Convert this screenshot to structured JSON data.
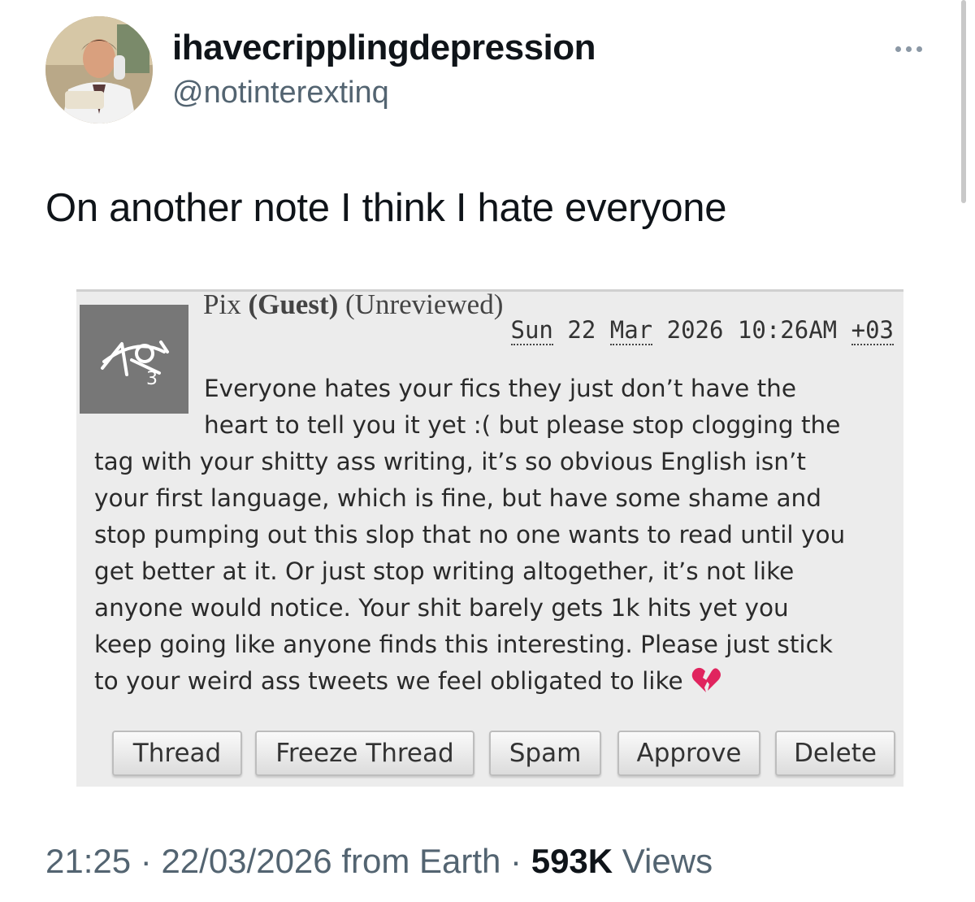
{
  "tweet": {
    "display_name": "ihavecripplingdepression",
    "handle": "@notinterextinq",
    "text": "On another note I think I hate everyone",
    "meta": {
      "time": "21:25",
      "sep1": " · ",
      "date": "22/03/2026",
      "source": " from Earth",
      "sep2": " · ",
      "views_count": "593K",
      "views_label": " Views"
    }
  },
  "comment": {
    "author": "Pix",
    "guest_label": "(Guest)",
    "status_label": "(Unreviewed)",
    "timestamp": {
      "day": "Sun",
      "date": "22",
      "month": "Mar",
      "year": "2026",
      "time": "10:26AM",
      "tz": "+03"
    },
    "body_lines": [
      "Everyone hates your fics they just don’t have the",
      "heart to tell you it yet :( but please stop clogging the",
      "tag with your shitty ass writing, it’s so obvious English isn’t",
      "your first language, which is fine, but have some shame and",
      "stop pumping out this slop that no one wants to read until you",
      "get better at it. Or just stop writing altogether, it’s not like",
      "anyone would notice. Your shit barely gets 1k hits yet you",
      "keep going like anyone finds this interesting. Please just stick",
      "to your weird ass tweets we feel obligated to like"
    ],
    "buttons": {
      "thread": "Thread",
      "freeze": "Freeze Thread",
      "spam": "Spam",
      "approve": "Approve",
      "delete": "Delete"
    }
  },
  "icons": {
    "avatar": "profile-photo",
    "more": "more-options-icon",
    "guest_icon": "ao3-logo-icon",
    "heart": "broken-heart-emoji"
  },
  "colors": {
    "text_primary": "#0f1419",
    "text_secondary": "#536471",
    "panel_bg": "#ececec",
    "icon_bg": "#777777",
    "heart_red": "#e0245e"
  }
}
